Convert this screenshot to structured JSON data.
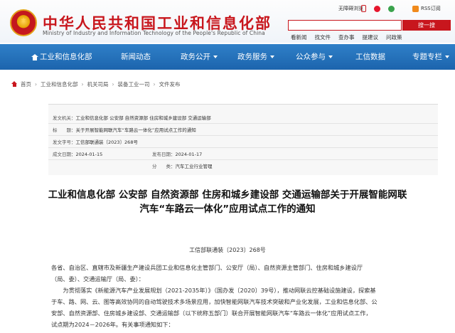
{
  "header": {
    "title_cn": "中华人民共和国工业和信息化部",
    "title_en": "Ministry of Industry and Information Technology of the People's Republic of China",
    "utility": {
      "barrier_free": "无障碍浏览",
      "rss": "RSS订阅"
    },
    "search": {
      "placeholder": "",
      "button": "搜一搜"
    },
    "quick_links": [
      "看新闻",
      "找文件",
      "查办事",
      "提建议",
      "问政策"
    ]
  },
  "nav": {
    "items": [
      {
        "label": "工业和信息化部",
        "has_home_icon": true
      },
      {
        "label": "新闻动态"
      },
      {
        "label": "政务公开",
        "has_arrow": true
      },
      {
        "label": "政务服务",
        "has_arrow": true
      },
      {
        "label": "公众参与",
        "has_arrow": true
      },
      {
        "label": "工信数据"
      },
      {
        "label": "专题专栏",
        "has_arrow": true
      }
    ]
  },
  "breadcrumb": [
    "首页",
    "工业和信息化部",
    "机关司局",
    "装备工业一司",
    "文件发布"
  ],
  "metadata": {
    "issuer_label": "发文机关：",
    "issuer_value": "工业和信息化部 公安部 自然资源部 住房和城乡建设部 交通运输部",
    "subject_label": "标　　题：",
    "subject_value": "关于开展智能网联汽车“车路云一体化”应用试点工作的通知",
    "doc_no_label": "发文字号：",
    "doc_no_value": "工信部联通装〔2023〕268号",
    "written_label": "成文日期：",
    "written_value": "2024-01-15",
    "published_label": "发布日期：",
    "published_value": "2024-01-17",
    "category_label": "分　　类：",
    "category_value": "汽车工业行业管理"
  },
  "document": {
    "title_line1": "工业和信息化部 公安部 自然资源部 住房和城乡建设部 交通运输部关于开展智能网联",
    "title_line2": "汽车“车路云一体化”应用试点工作的通知",
    "number": "工信部联通装〔2023〕268号",
    "paragraphs": [
      "各省、自治区、直辖市及新疆生产建设兵团工业和信息化主管部门、公安厅（局）、自然资源主管部门、住房和城乡建设厅",
      "（局、委）、交通运输厅（局、委）：",
      "　　为贯彻落实《新能源汽车产业发展规划（2021-2035年）》（国办发〔2020〕39号），推动网联云控基础设施建设，探索基",
      "于车、路、网、云、图等高效协同的自动驾驶技术多场景应用，加快智能网联汽车技术突破和产业化发展，工业和信息化部、公",
      "安部、自然资源部、住房城乡建设部、交通运输部（以下统称五部门）联合开展智能网联汽车“车路云一体化”应用试点工作，",
      "试点期为2024－2026年。有关事项通知如下："
    ]
  },
  "colors": {
    "brand_red": "#c8161d",
    "nav_blue": "#1f6ab2"
  }
}
